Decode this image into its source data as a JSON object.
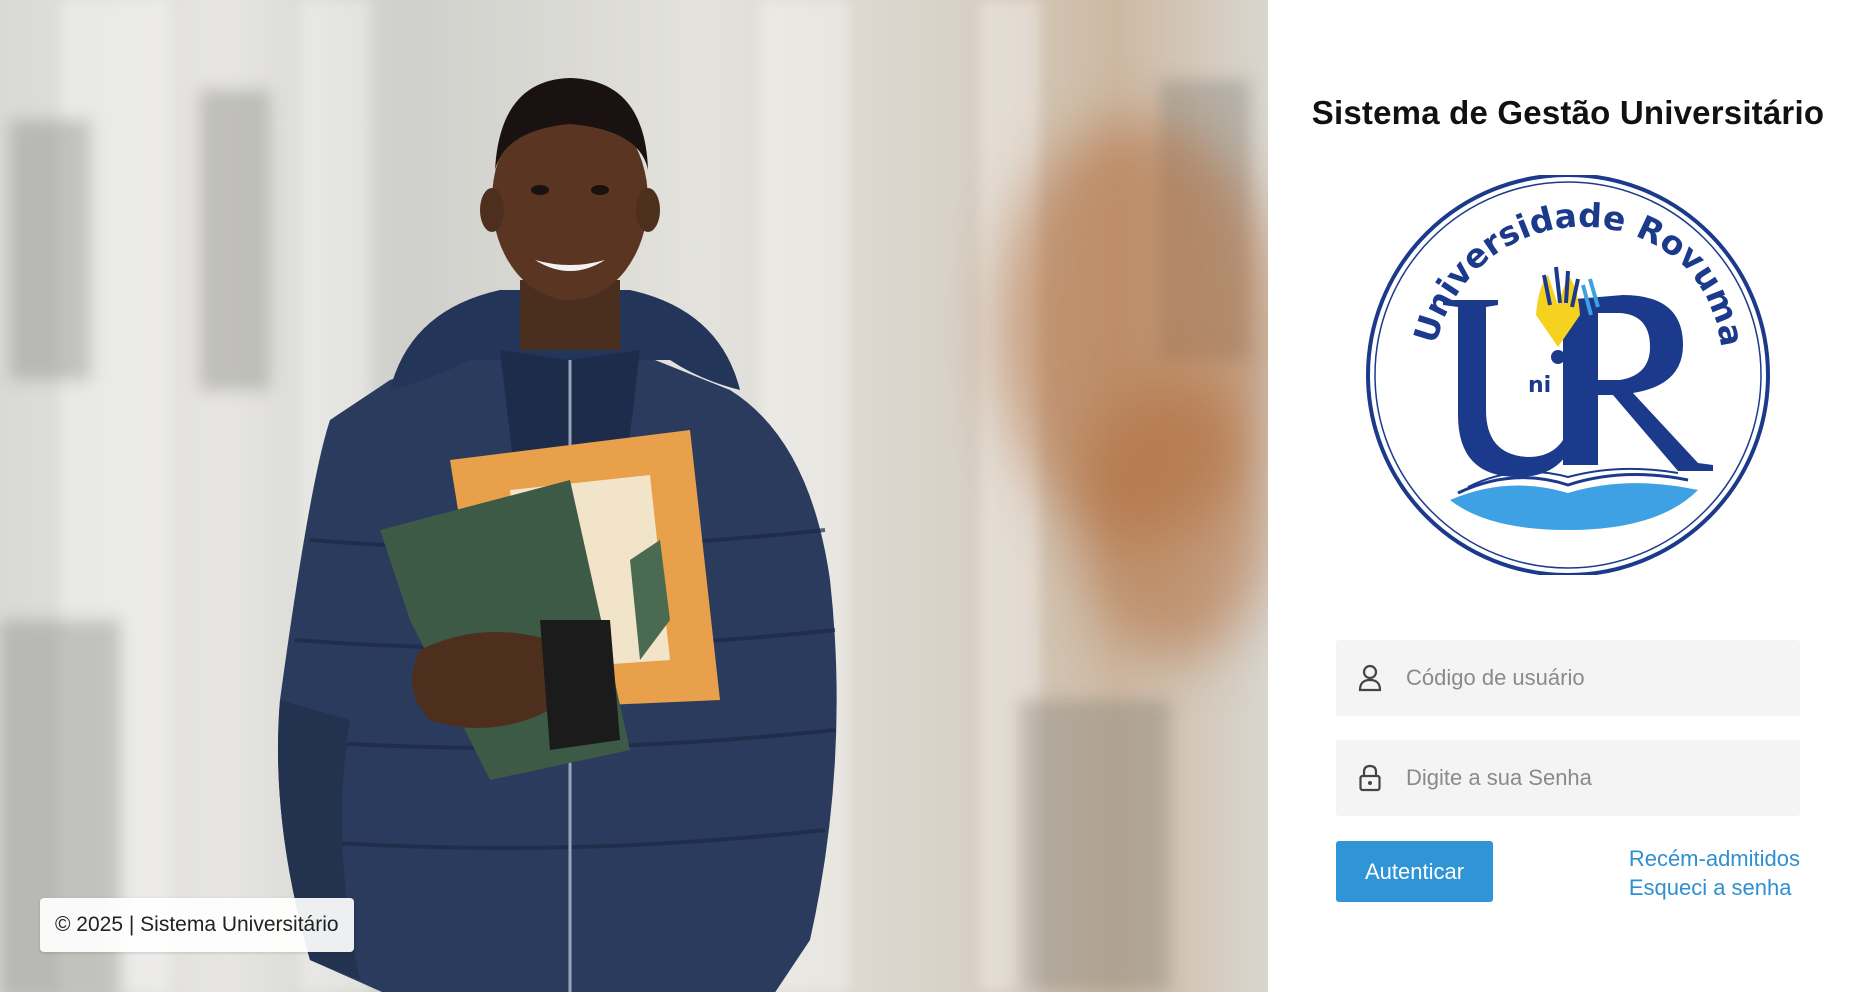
{
  "app": {
    "title": "Sistema de Gestão Universitário"
  },
  "logo": {
    "arc_text": "Universidade Rovuma",
    "letters": "UniR",
    "colors": {
      "navy": "#1b3a8c",
      "yellow": "#f4d21f",
      "sky": "#3ea1e3"
    }
  },
  "login": {
    "username": {
      "placeholder": "Código de usuário",
      "value": "",
      "icon": "user-icon"
    },
    "password": {
      "placeholder": "Digite a sua Senha",
      "value": "",
      "icon": "lock-icon"
    },
    "submit_label": "Autenticar"
  },
  "links": {
    "new_admits": "Recém-admitidos",
    "forgot_password": "Esqueci a senha"
  },
  "footer": {
    "copyright": "© 2025 | Sistema Universitário"
  },
  "colors": {
    "accent": "#2f95d6",
    "link": "#2e8fd2",
    "field_bg": "#f4f4f4"
  }
}
